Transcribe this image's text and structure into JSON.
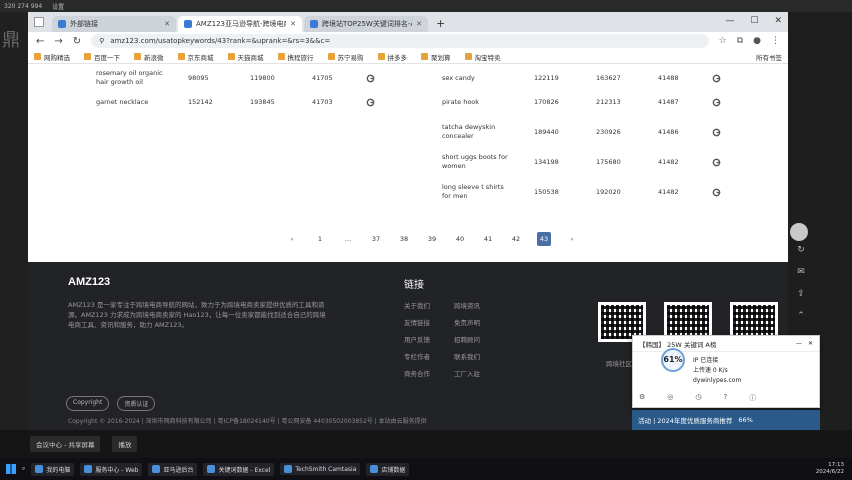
{
  "top_strip": {
    "left_text": "320 274 994",
    "mid_text": "设置"
  },
  "tabs": [
    {
      "title": "外部链接",
      "active": false
    },
    {
      "title": "AMZ123亚马逊导航-跨境电商",
      "active": true
    },
    {
      "title": "跨境站TOP25W关键词排名-A",
      "active": false
    }
  ],
  "browser": {
    "url": "amz123.com/usatopkeywords/43?rank=&uprank=&rs=3&&c=",
    "bookmarks": [
      "网购精选",
      "百度一下",
      "新浪微",
      "京东商城",
      "天猫商城",
      "携程旅行",
      "苏宁易购",
      "拼多多",
      "聚划算",
      "淘宝特卖"
    ],
    "bookmarks_right": "所有书签"
  },
  "keywords_left": [
    {
      "kw": "rosemary oil organic hair growth oil",
      "n1": "98095",
      "n2": "119800",
      "n3": "41705"
    },
    {
      "kw": "garnet necklace",
      "n1": "152142",
      "n2": "193845",
      "n3": "41703"
    }
  ],
  "keywords_right": [
    {
      "kw": "sex candy",
      "n1": "122119",
      "n2": "163627",
      "n3": "41488"
    },
    {
      "kw": "pirate hook",
      "n1": "170826",
      "n2": "212313",
      "n3": "41487"
    },
    {
      "kw": "tatcha dewyskin concealer",
      "n1": "189440",
      "n2": "230926",
      "n3": "41486"
    },
    {
      "kw": "short uggs boots for women",
      "n1": "134198",
      "n2": "175680",
      "n3": "41482"
    },
    {
      "kw": "long sleeve t shirts for men",
      "n1": "150538",
      "n2": "192020",
      "n3": "41482"
    }
  ],
  "pager": [
    "‹",
    "1",
    "…",
    "37",
    "38",
    "39",
    "40",
    "41",
    "42",
    "43",
    "›"
  ],
  "footer": {
    "brand": "AMZ123",
    "desc": "AMZ123 是一家专注于跨境电商导航的网站，致力于为跨境电商卖家提供优质的工具和资源。AMZ123 力求成为跨境电商卖家的 Hao123，让每一位卖家都能找到适合自己的跨境电商工具、资讯和服务，助力 AMZ123。",
    "links_title": "链接",
    "links": [
      "关于我们",
      "跨境资讯",
      "友情链接",
      "免责声明",
      "用户反馈",
      "招聘顾问",
      "专栏作者",
      "联系我们",
      "商务合作",
      "工厂入驻"
    ],
    "qr_caption": "跨境社区",
    "badges": [
      "Copyright",
      "资质认证"
    ],
    "copyright": "Copyright © 2016-2024 | 深圳市网商科技有限公司 | 粤ICP备18024140号 | 粤公网安备 44030502003852号 | 本站由云服务提供"
  },
  "popup": {
    "title": "【韩国】 25W 关键词 A榜",
    "percent": "61%",
    "lines": [
      "IP 已连接",
      "上传速 0 K/s"
    ],
    "link_text": "dywinlypes.com"
  },
  "banner": {
    "text": "活动 | 2024年度优质服务商推荐",
    "percent": "66%"
  },
  "secondbar": [
    "会议中心 - 共享屏幕",
    "播放"
  ],
  "taskbar": {
    "apps": [
      "我的电脑",
      "服务中心 - Web",
      "亚马逊后台",
      "关键词数据 - Excel",
      "TechSmith Camtasia",
      "店铺数据"
    ],
    "time": "17:13",
    "date": "2024/6/22"
  }
}
